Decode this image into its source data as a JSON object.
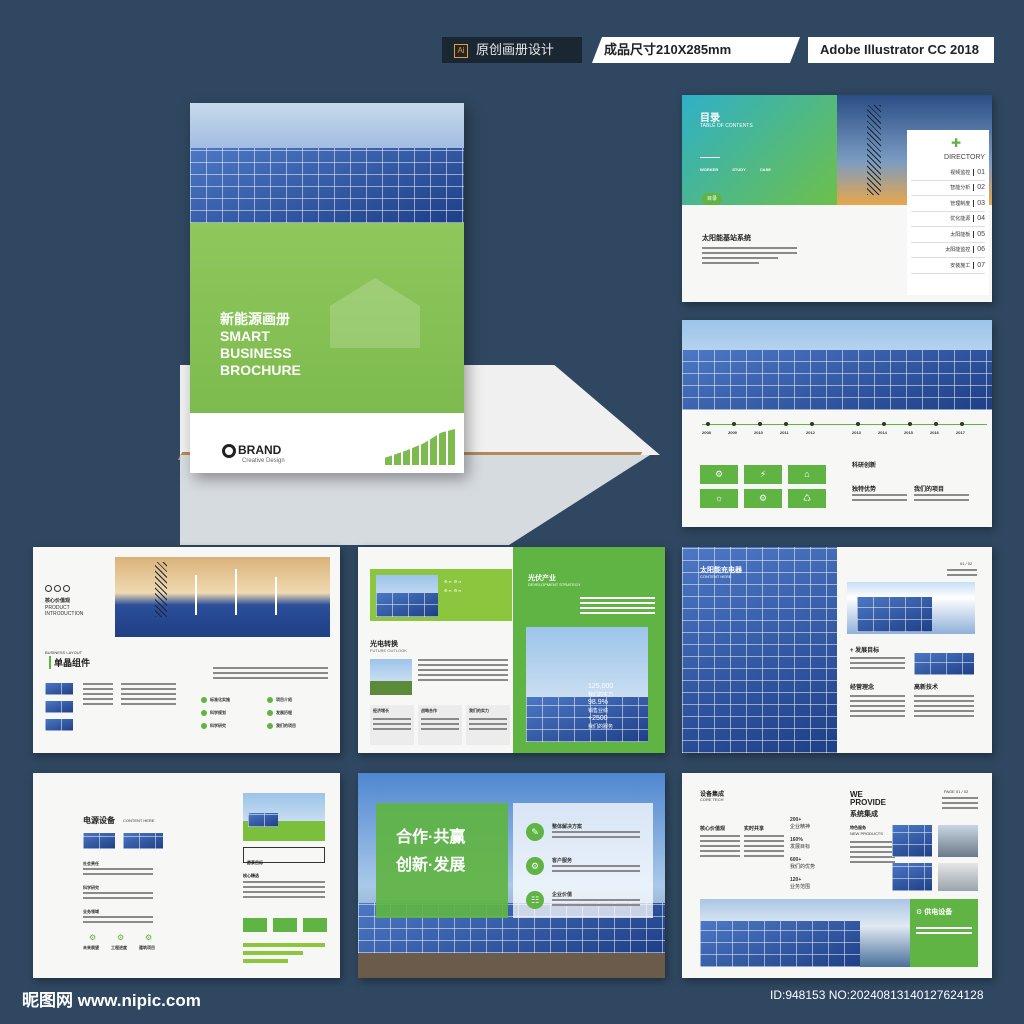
{
  "header": {
    "tag1": "原创画册设计",
    "tag1_icon": "Ai",
    "tag2": "成品尺寸210X285mm",
    "tag3": "Adobe Illustrator CC 2018"
  },
  "cover": {
    "title_cn": "新能源画册",
    "title_en_1": "SMART",
    "title_en_2": "BUSINESS",
    "title_en_3": "BROCHURE",
    "brand": "BRAND",
    "brand_sub": "Creative Design"
  },
  "page_toc": {
    "title": "目录",
    "subtitle": "TABLE OF CONTENTS",
    "tabs": [
      "WORKER",
      "STUDY",
      "CASE"
    ],
    "badge": "目录",
    "section_title": "太阳能基站系统",
    "directory_label": "DIRECTORY",
    "items": [
      {
        "label": "视频监控",
        "num": "01"
      },
      {
        "label": "智能分析",
        "num": "02"
      },
      {
        "label": "管理制度",
        "num": "03"
      },
      {
        "label": "优化能源",
        "num": "04"
      },
      {
        "label": "太阳能板",
        "num": "05"
      },
      {
        "label": "太阳能监控",
        "num": "06"
      },
      {
        "label": "安装施工",
        "num": "07"
      }
    ]
  },
  "page_timeline": {
    "years_left": [
      "2008",
      "2009",
      "2010",
      "2011",
      "2012"
    ],
    "years_right": [
      "2013",
      "2014",
      "2015",
      "2016",
      "2017"
    ],
    "label_a": "科研创新",
    "label_b": "独特优势",
    "label_c": "我们的项目"
  },
  "page_product": {
    "core_value": "核心价值观",
    "product_intro": "PRODUCT INTRODUCTION",
    "layout_label": "BUSINESS LAYOUT",
    "component_title": "单晶组件",
    "checks": [
      "标准化实施",
      "项目介绍",
      "科学规划",
      "发展历程",
      "科学研究",
      "我们的项目"
    ]
  },
  "page_pv": {
    "industry": "光伏产业",
    "industry_sub": "DEVELOPMENT STRATEGY",
    "convert": "光电转换",
    "convert_sub": "FUTURE OUTLOOK",
    "cols": [
      "经济增长",
      "战略合作",
      "我们的实力"
    ],
    "stat1": "125,000",
    "stat1_label": "我们的实力",
    "stat2": "98.9%",
    "stat2_label": "销售业绩",
    "stat3": "+2500",
    "stat3_label": "我们的服务"
  },
  "page_charger": {
    "title": "太阳能充电器",
    "subtitle": "CONTENT HERE",
    "page_num": "01 / 02",
    "goal": "+ 发展目标",
    "concept": "经营理念",
    "tech": "高新技术"
  },
  "page_power": {
    "title": "电源设备",
    "subtitle": "CONTENT HERE",
    "items": [
      "社会责任",
      "科学研究",
      "业务领域"
    ],
    "icons": [
      "未来展望",
      "工程进度",
      "建筑项目"
    ],
    "goal": "愿景目标",
    "core": "核心精选"
  },
  "page_coop": {
    "slogan_1": "合作·共赢",
    "slogan_2": "创新·发展",
    "items": [
      "整体解决方案",
      "客户服务",
      "企业价值"
    ]
  },
  "page_system": {
    "title": "设备集成",
    "subtitle": "CORE TECH",
    "we_provide_1": "WE",
    "we_provide_2": "PROVIDE",
    "system_cn": "系统集成",
    "feature": "特色服务",
    "new_products": "NEW PRODUCTS",
    "page_num": "PAGE 01 / 02",
    "core": "核心价值观",
    "service": "实时共享",
    "stats": [
      {
        "v": "200+",
        "l": "企业精神"
      },
      {
        "v": "160%",
        "l": "发展目标"
      },
      {
        "v": "600+",
        "l": "我们的优势"
      },
      {
        "v": "120+",
        "l": "业务范围"
      }
    ],
    "supply": "供电设备"
  },
  "footer": {
    "logo": "昵图网 www.nipic.com",
    "id": "ID:948153 NO:20240813140127624128"
  },
  "colors": {
    "background": "#2f4760",
    "brand_green": "#5fb443",
    "light_green": "#8cc63f",
    "panel_blue": "#2c4f9a"
  }
}
